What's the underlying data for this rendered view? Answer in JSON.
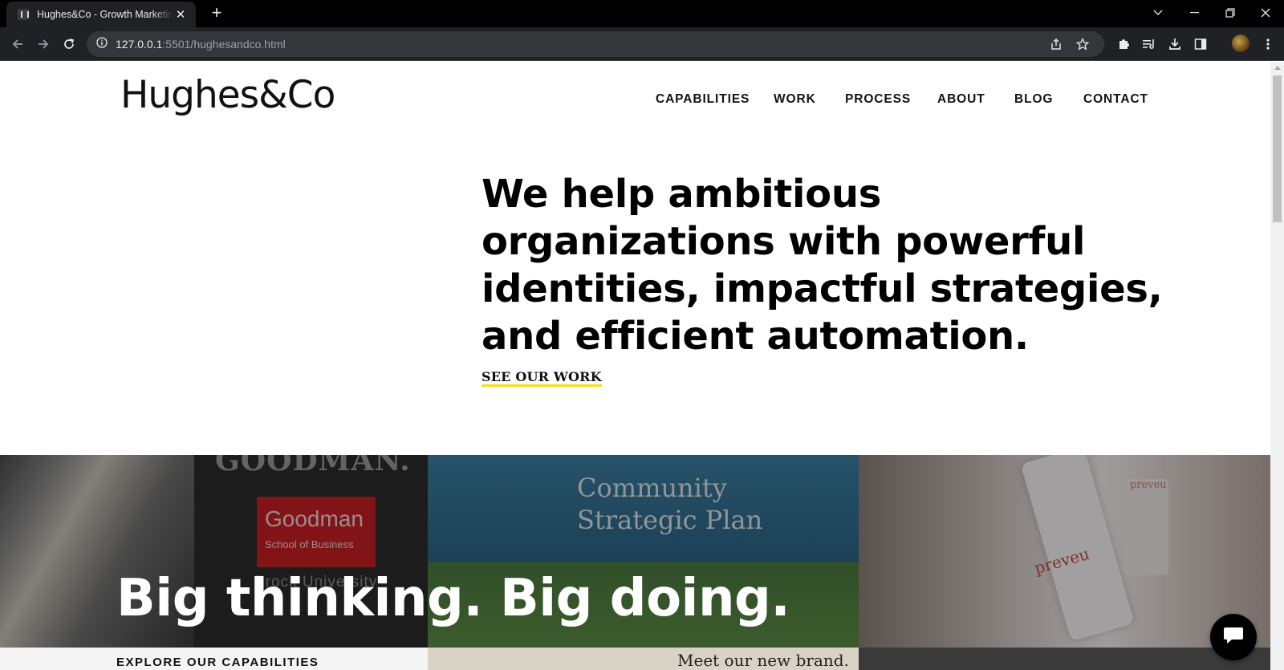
{
  "browser": {
    "tab_title": "Hughes&Co - Growth Marketing",
    "tab_close_glyph": "✕",
    "new_tab_glyph": "+",
    "url_host": "127.0.0.1",
    "url_path": ":5501/hughesandco.html"
  },
  "site": {
    "logo": "Hughes&Co",
    "nav": [
      "CAPABILITIES",
      "WORK",
      "PROCESS",
      "ABOUT",
      "BLOG",
      "CONTACT"
    ]
  },
  "hero": {
    "lines": [
      "We help ambitious",
      "organizations with powerful",
      "identities, impactful strategies,",
      "and efficient automation."
    ],
    "cta": "SEE OUR WORK"
  },
  "band": {
    "headline": "Big thinking. Big doing.",
    "goodman_header": "GOODMAN.",
    "goodman_name": "Goodman",
    "goodman_sub": "School of Business",
    "goodman_university": "Brock University",
    "community_line1": "Community",
    "community_line2": "Strategic Plan",
    "bottle1_text": "preveu",
    "bottle2_text": "preveu",
    "explore": "EXPLORE OUR CAPABILITIES",
    "meet": "Meet our new brand."
  },
  "colors": {
    "cta_underline": "#f2e21b",
    "chrome_dark": "#202124",
    "goodman_red": "#c81f24"
  }
}
